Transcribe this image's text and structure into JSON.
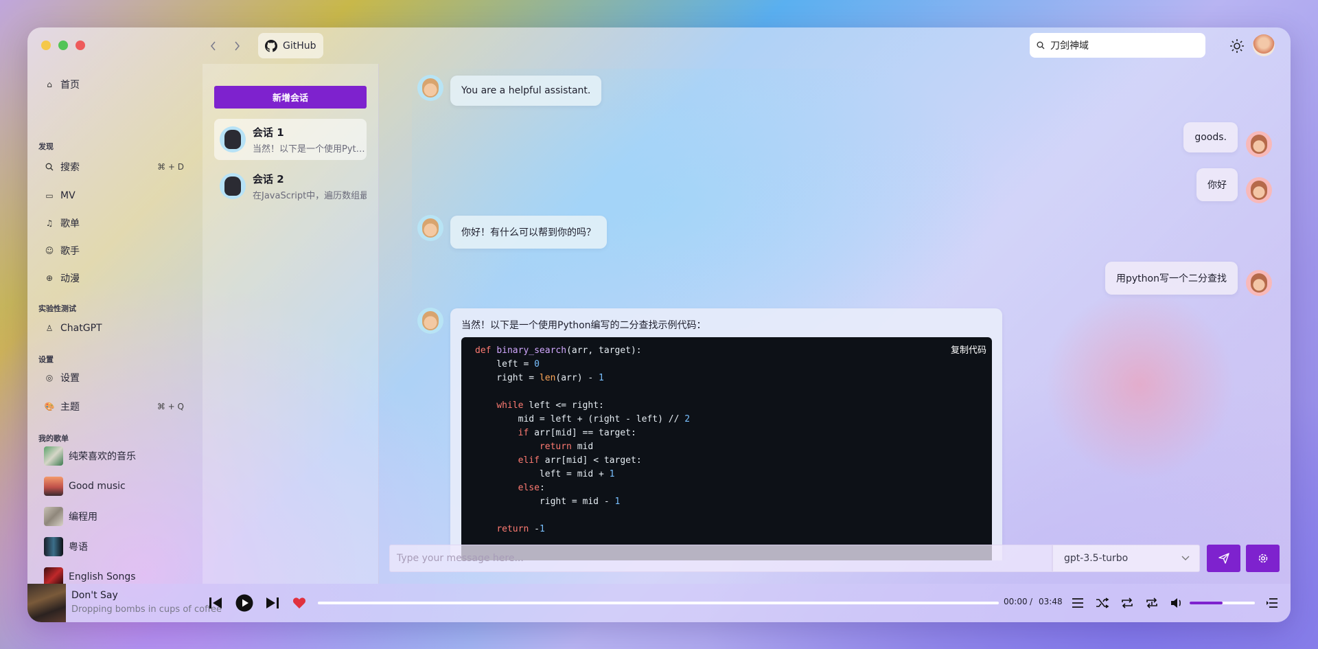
{
  "titlebar": {
    "github_label": "GitHub",
    "search_value": "刀剑神域"
  },
  "sidebar": {
    "home": "首页",
    "section_discover": "发现",
    "search": "搜索",
    "search_shortcut": "⌘ + D",
    "mv": "MV",
    "playlists": "歌单",
    "artists": "歌手",
    "anime": "动漫",
    "section_experimental": "实验性测试",
    "chatgpt": "ChatGPT",
    "section_settings": "设置",
    "settings": "设置",
    "theme": "主题",
    "theme_shortcut": "⌘ + Q",
    "section_my_playlists": "我的歌单",
    "my_playlists": [
      {
        "label": "纯荣喜欢的音乐"
      },
      {
        "label": "Good music"
      },
      {
        "label": "编程用"
      },
      {
        "label": "粤语"
      },
      {
        "label": "English Songs"
      }
    ]
  },
  "conversations": {
    "new_button": "新增会话",
    "items": [
      {
        "title": "会话 1",
        "preview": "当然！以下是一个使用Python编写的二分查找示例代码："
      },
      {
        "title": "会话 2",
        "preview": "在JavaScript中，遍历数组最常用的方法"
      }
    ]
  },
  "chat": {
    "messages": [
      {
        "role": "bot",
        "text": "You are a helpful assistant."
      },
      {
        "role": "user",
        "text": "goods."
      },
      {
        "role": "user",
        "text": "你好"
      },
      {
        "role": "bot",
        "text": "你好！有什么可以帮到你的吗？"
      },
      {
        "role": "user",
        "text": "用python写一个二分查找"
      },
      {
        "role": "bot",
        "text": "当然！以下是一个使用Python编写的二分查找示例代码："
      }
    ],
    "copy_code": "复制代码",
    "input_placeholder": "Type your message here...",
    "model": "gpt-3.5-turbo"
  },
  "player": {
    "title": "Don't Say",
    "artist": "Dropping bombs in cups of coffee",
    "current_time": "00:00",
    "separator": "/",
    "total_time": "03:48",
    "progress": 0,
    "volume": 0.5
  },
  "colors": {
    "accent": "#7e22ce",
    "code_bg": "#0d1117"
  }
}
